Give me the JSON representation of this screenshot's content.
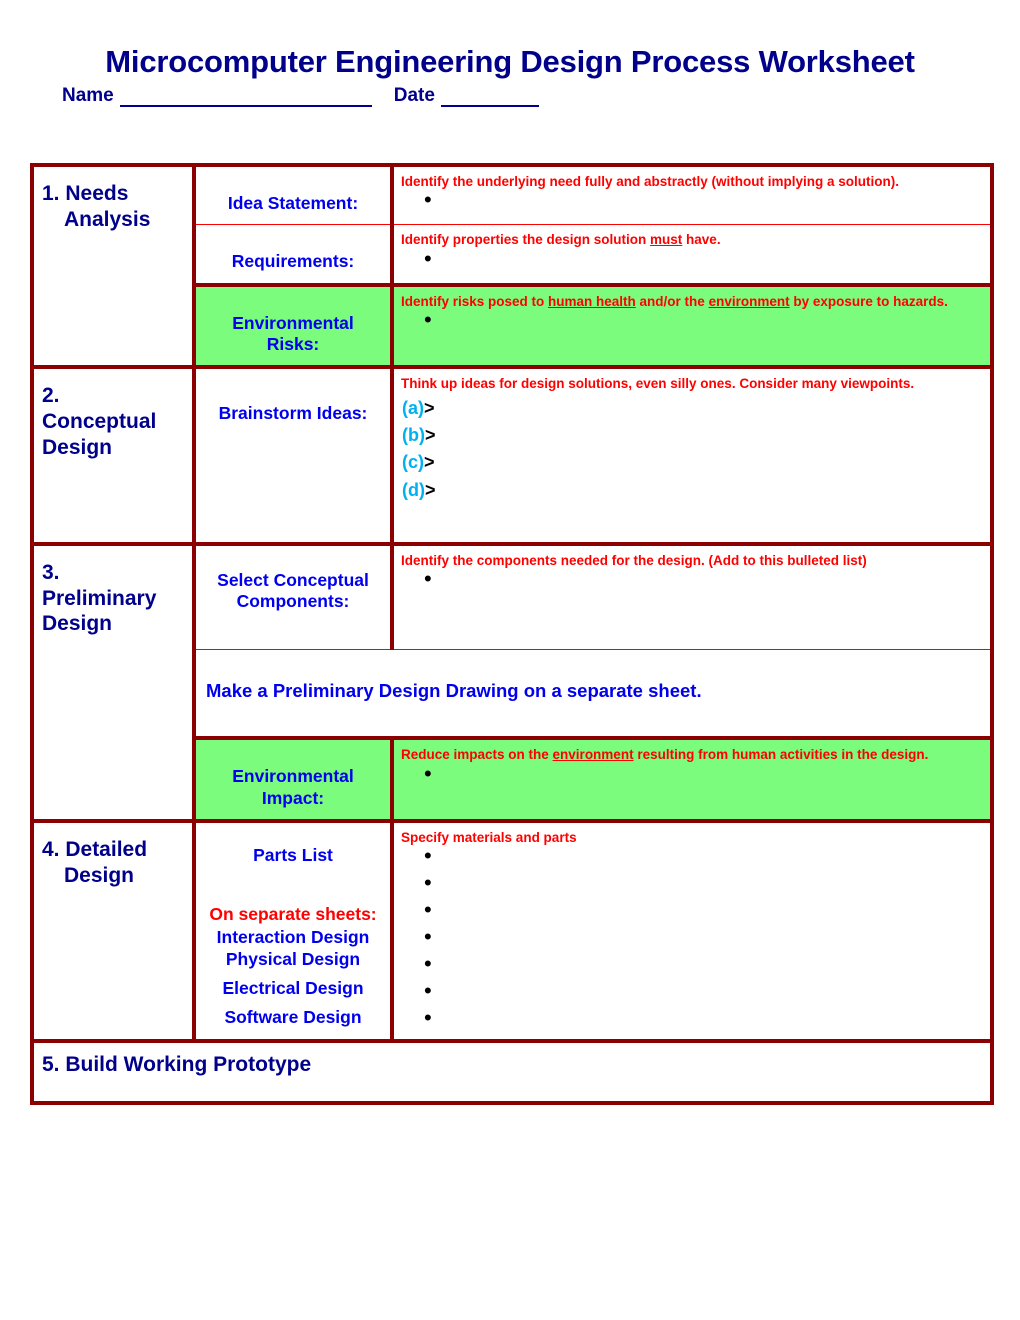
{
  "header": {
    "title": "Microcomputer Engineering Design Process Worksheet",
    "name_label": "Name",
    "date_label": "Date"
  },
  "sections": [
    {
      "number_label": "1. Needs",
      "number_label_line2": "Analysis",
      "rows": [
        {
          "sublabel": "Idea Statement:",
          "instruction": "Identify the underlying need fully and abstractly (without implying a solution).",
          "bullets": 1,
          "highlight": false
        },
        {
          "sublabel": "Requirements:",
          "instruction_pre": "Identify properties the design solution ",
          "instruction_underline": "must",
          "instruction_post": " have.",
          "bullets": 1,
          "highlight": false
        },
        {
          "sublabel": "Environmental Risks:",
          "instruction_pre": "Identify risks posed to ",
          "instruction_underline": "human health",
          "instruction_mid": " and/or the ",
          "instruction_underline2": "environment",
          "instruction_post": " by exposure to hazards.",
          "bullets": 1,
          "highlight": true
        }
      ]
    },
    {
      "number_label": "2.",
      "number_label_line2": "Conceptual Design",
      "rows": [
        {
          "sublabel": "Brainstorm Ideas:",
          "instruction": "Think up ideas for design solutions, even silly ones.  Consider many viewpoints.",
          "lettered": [
            "(a)",
            "(b)",
            "(c)",
            "(d)"
          ],
          "arrow": ">",
          "highlight": false
        }
      ]
    },
    {
      "number_label": "3.",
      "number_label_line2": "Preliminary Design",
      "rows": [
        {
          "sublabel": "Select Conceptual Components:",
          "instruction": "Identify the components needed for the design. (Add to this bulleted list)",
          "bullets": 1,
          "highlight": false
        },
        {
          "merged_note": "Make a Preliminary Design Drawing on a separate sheet.",
          "highlight": false
        },
        {
          "sublabel": "Environmental Impact:",
          "instruction_pre": "Reduce impacts on the ",
          "instruction_underline": "environment",
          "instruction_post": " resulting from human activities in the design.",
          "bullets": 1,
          "highlight": true
        }
      ]
    },
    {
      "number_label": "4. Detailed",
      "number_label_line2": "Design",
      "rows": [
        {
          "sublabel": "Parts List",
          "on_separate_sheets": "On separate sheets:",
          "separate_items": [
            "Interaction Design Physical Design",
            "Electrical Design",
            "Software Design"
          ],
          "instruction": "Specify materials and parts",
          "bullets": 7,
          "highlight": false
        }
      ]
    }
  ],
  "final_row": {
    "label": "5. Build Working Prototype"
  },
  "colors": {
    "title_navy": "#00008B",
    "sublabel_blue": "#0000EE",
    "instruction_red": "#FF0000",
    "border_maroon": "#8B0000",
    "inner_rule_red": "#FF0000",
    "highlight_green": "#7CFC7C",
    "letter_cyan": "#00B0F0"
  }
}
